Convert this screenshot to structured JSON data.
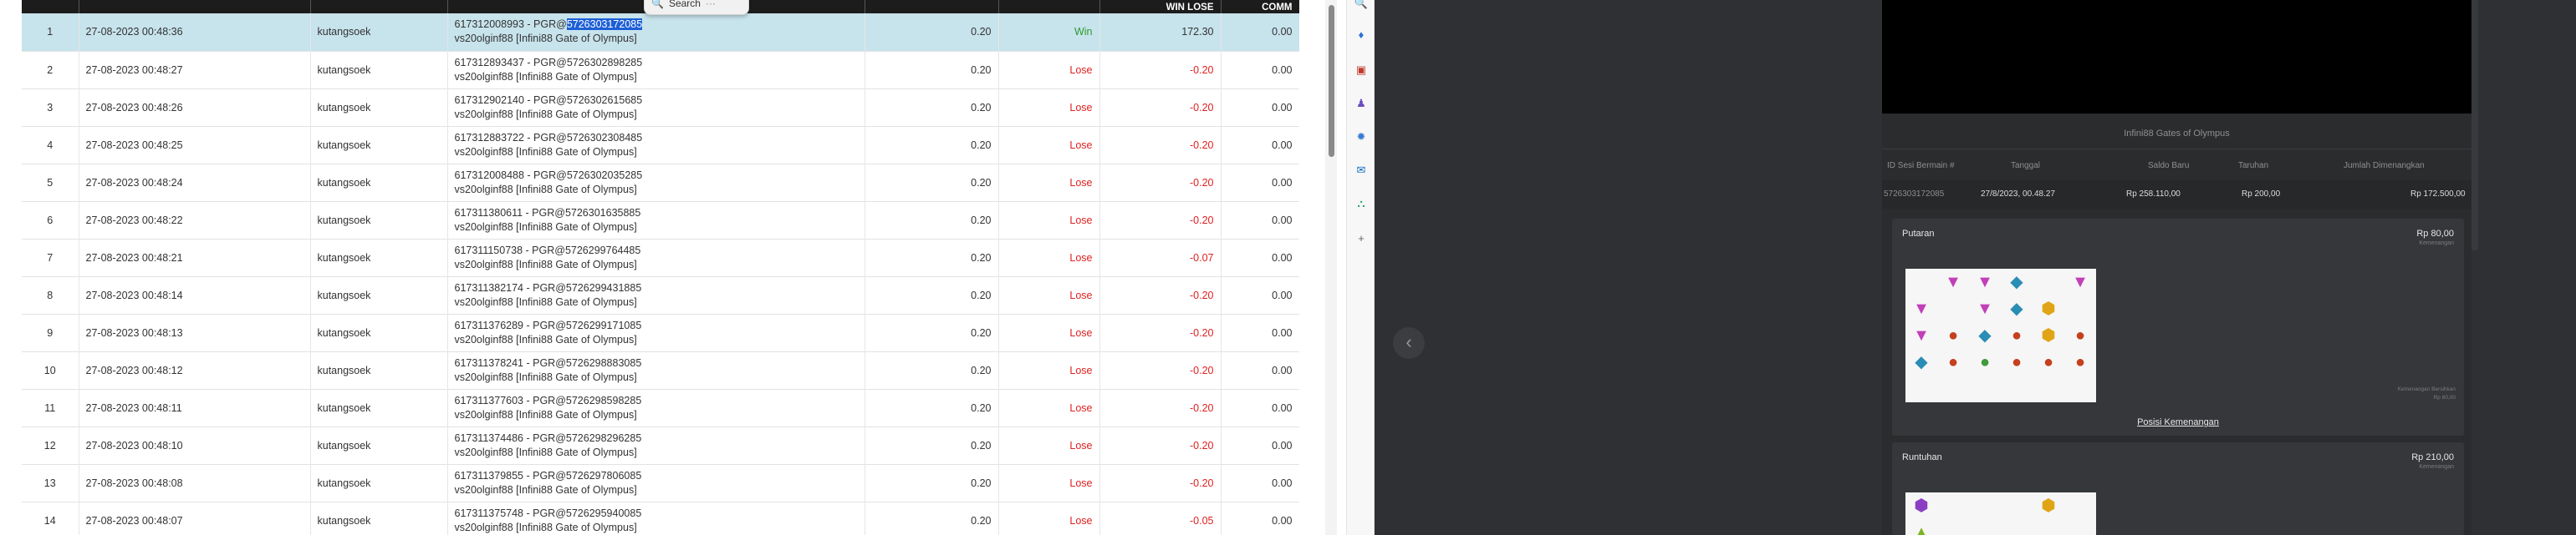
{
  "table": {
    "headers": [
      "",
      "",
      "",
      "",
      "",
      "",
      "WIN LOSE",
      "COMM"
    ],
    "rows": [
      {
        "no": "1",
        "date": "27-08-2023 00:48:36",
        "user": "kutangsoek",
        "ref_prefix": "617312008993 - PGR@",
        "ref_id": "5726303172085",
        "game": "vs20olginf88 [Infini88 Gate of Olympus]",
        "bet": "0.20",
        "status": "Win",
        "win_lose": "172.30",
        "comm": "0.00"
      },
      {
        "no": "2",
        "date": "27-08-2023 00:48:27",
        "user": "kutangsoek",
        "ref_prefix": "617312893437 - PGR@",
        "ref_id": "5726302898285",
        "game": "vs20olginf88 [Infini88 Gate of Olympus]",
        "bet": "0.20",
        "status": "Lose",
        "win_lose": "-0.20",
        "comm": "0.00"
      },
      {
        "no": "3",
        "date": "27-08-2023 00:48:26",
        "user": "kutangsoek",
        "ref_prefix": "617312902140 - PGR@",
        "ref_id": "5726302615685",
        "game": "vs20olginf88 [Infini88 Gate of Olympus]",
        "bet": "0.20",
        "status": "Lose",
        "win_lose": "-0.20",
        "comm": "0.00"
      },
      {
        "no": "4",
        "date": "27-08-2023 00:48:25",
        "user": "kutangsoek",
        "ref_prefix": "617312883722 - PGR@",
        "ref_id": "5726302308485",
        "game": "vs20olginf88 [Infini88 Gate of Olympus]",
        "bet": "0.20",
        "status": "Lose",
        "win_lose": "-0.20",
        "comm": "0.00"
      },
      {
        "no": "5",
        "date": "27-08-2023 00:48:24",
        "user": "kutangsoek",
        "ref_prefix": "617312008488 - PGR@",
        "ref_id": "5726302035285",
        "game": "vs20olginf88 [Infini88 Gate of Olympus]",
        "bet": "0.20",
        "status": "Lose",
        "win_lose": "-0.20",
        "comm": "0.00"
      },
      {
        "no": "6",
        "date": "27-08-2023 00:48:22",
        "user": "kutangsoek",
        "ref_prefix": "617311380611 - PGR@",
        "ref_id": "5726301635885",
        "game": "vs20olginf88 [Infini88 Gate of Olympus]",
        "bet": "0.20",
        "status": "Lose",
        "win_lose": "-0.20",
        "comm": "0.00"
      },
      {
        "no": "7",
        "date": "27-08-2023 00:48:21",
        "user": "kutangsoek",
        "ref_prefix": "617311150738 - PGR@",
        "ref_id": "5726299764485",
        "game": "vs20olginf88 [Infini88 Gate of Olympus]",
        "bet": "0.20",
        "status": "Lose",
        "win_lose": "-0.07",
        "comm": "0.00"
      },
      {
        "no": "8",
        "date": "27-08-2023 00:48:14",
        "user": "kutangsoek",
        "ref_prefix": "617311382174 - PGR@",
        "ref_id": "5726299431885",
        "game": "vs20olginf88 [Infini88 Gate of Olympus]",
        "bet": "0.20",
        "status": "Lose",
        "win_lose": "-0.20",
        "comm": "0.00"
      },
      {
        "no": "9",
        "date": "27-08-2023 00:48:13",
        "user": "kutangsoek",
        "ref_prefix": "617311376289 - PGR@",
        "ref_id": "5726299171085",
        "game": "vs20olginf88 [Infini88 Gate of Olympus]",
        "bet": "0.20",
        "status": "Lose",
        "win_lose": "-0.20",
        "comm": "0.00"
      },
      {
        "no": "10",
        "date": "27-08-2023 00:48:12",
        "user": "kutangsoek",
        "ref_prefix": "617311378241 - PGR@",
        "ref_id": "5726298883085",
        "game": "vs20olginf88 [Infini88 Gate of Olympus]",
        "bet": "0.20",
        "status": "Lose",
        "win_lose": "-0.20",
        "comm": "0.00"
      },
      {
        "no": "11",
        "date": "27-08-2023 00:48:11",
        "user": "kutangsoek",
        "ref_prefix": "617311377603 - PGR@",
        "ref_id": "5726298598285",
        "game": "vs20olginf88 [Infini88 Gate of Olympus]",
        "bet": "0.20",
        "status": "Lose",
        "win_lose": "-0.20",
        "comm": "0.00"
      },
      {
        "no": "12",
        "date": "27-08-2023 00:48:10",
        "user": "kutangsoek",
        "ref_prefix": "617311374486 - PGR@",
        "ref_id": "5726298296285",
        "game": "vs20olginf88 [Infini88 Gate of Olympus]",
        "bet": "0.20",
        "status": "Lose",
        "win_lose": "-0.20",
        "comm": "0.00"
      },
      {
        "no": "13",
        "date": "27-08-2023 00:48:08",
        "user": "kutangsoek",
        "ref_prefix": "617311379855 - PGR@",
        "ref_id": "5726297806085",
        "game": "vs20olginf88 [Infini88 Gate of Olympus]",
        "bet": "0.20",
        "status": "Lose",
        "win_lose": "-0.20",
        "comm": "0.00"
      },
      {
        "no": "14",
        "date": "27-08-2023 00:48:07",
        "user": "kutangsoek",
        "ref_prefix": "617311375748 - PGR@",
        "ref_id": "5726295940085",
        "game": "vs20olginf88 [Infini88 Gate of Olympus]",
        "bet": "0.20",
        "status": "Lose",
        "win_lose": "-0.05",
        "comm": "0.00"
      }
    ]
  },
  "search_popup": {
    "label": "Search",
    "more": "···"
  },
  "side_rail": {
    "icons": [
      "search-icon",
      "tag-icon",
      "briefcase-icon",
      "chess-icon",
      "copilot-icon",
      "outlook-icon",
      "cart-icon",
      "plus-icon"
    ]
  },
  "game_detail": {
    "title": "Infini88 Gates of Olympus",
    "headers": {
      "id": "ID Sesi Bermain #",
      "date": "Tanggal",
      "balance": "Saldo Baru",
      "bet": "Taruhan",
      "win": "Jumlah Dimenangkan"
    },
    "values": {
      "id": "5726303172085",
      "date": "27/8/2023, 00.48.27",
      "balance": "Rp 258.110,00",
      "bet": "Rp 200,00",
      "win": "Rp 172.500,00"
    },
    "spin": {
      "label": "Putaran",
      "amount": "Rp 80,00",
      "sub": "Kemenangan",
      "win_positions": "Posisi Kemenangan",
      "note_line1": "Kemenangan Bersihkan",
      "note_line2": "Rp 80,00"
    },
    "tumble": {
      "label": "Runtuhan",
      "amount": "Rp 210,00",
      "sub": "Kemenangan"
    },
    "nav_prev": "‹"
  },
  "colors": {
    "win": "#2e9a2e",
    "lose": "#e02020",
    "selection": "#c7e3ec",
    "highlight": "#1d5fd6",
    "panel": "#2b2c2e"
  }
}
